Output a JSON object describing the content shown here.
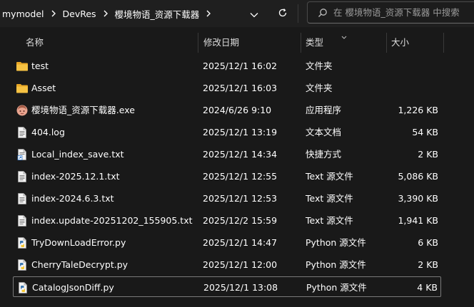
{
  "breadcrumb": {
    "items": [
      "mymodel",
      "DevRes",
      "樱境物语_资源下载器"
    ]
  },
  "search": {
    "placeholder": "在 樱境物语_资源下载器 中搜索"
  },
  "columns": {
    "name": "名称",
    "date": "修改日期",
    "type": "类型",
    "size": "大小"
  },
  "files": [
    {
      "name": "test",
      "date": "2025/12/1 16:02",
      "type": "文件夹",
      "size": "",
      "icon": "folder-icon"
    },
    {
      "name": "Asset",
      "date": "2025/12/1 16:03",
      "type": "文件夹",
      "size": "",
      "icon": "folder-icon"
    },
    {
      "name": "樱境物语_资源下载器.exe",
      "date": "2024/6/26 9:10",
      "type": "应用程序",
      "size": "1,226 KB",
      "icon": "app-icon"
    },
    {
      "name": "404.log",
      "date": "2025/12/1 13:19",
      "type": "文本文档",
      "size": "54 KB",
      "icon": "text-file-icon"
    },
    {
      "name": "Local_index_save.txt",
      "date": "2025/12/1 14:34",
      "type": "快捷方式",
      "size": "2 KB",
      "icon": "shortcut-icon"
    },
    {
      "name": "index-2025.12.1.txt",
      "date": "2025/12/1 12:55",
      "type": "Text 源文件",
      "size": "5,086 KB",
      "icon": "text-file-icon"
    },
    {
      "name": "index-2024.6.3.txt",
      "date": "2025/12/1 12:53",
      "type": "Text 源文件",
      "size": "3,390 KB",
      "icon": "text-file-icon"
    },
    {
      "name": "index.update-20251202_155905.txt",
      "date": "2025/12/2 15:59",
      "type": "Text 源文件",
      "size": "1,941 KB",
      "icon": "text-file-icon"
    },
    {
      "name": "TryDownLoadError.py",
      "date": "2025/12/1 14:47",
      "type": "Python 源文件",
      "size": "6 KB",
      "icon": "python-file-icon"
    },
    {
      "name": "CherryTaleDecrypt.py",
      "date": "2025/12/1 12:00",
      "type": "Python 源文件",
      "size": "2 KB",
      "icon": "python-file-icon"
    },
    {
      "name": "CatalogJsonDiff.py",
      "date": "2025/12/1 13:08",
      "type": "Python 源文件",
      "size": "4 KB",
      "icon": "python-file-icon",
      "selected": true
    }
  ]
}
